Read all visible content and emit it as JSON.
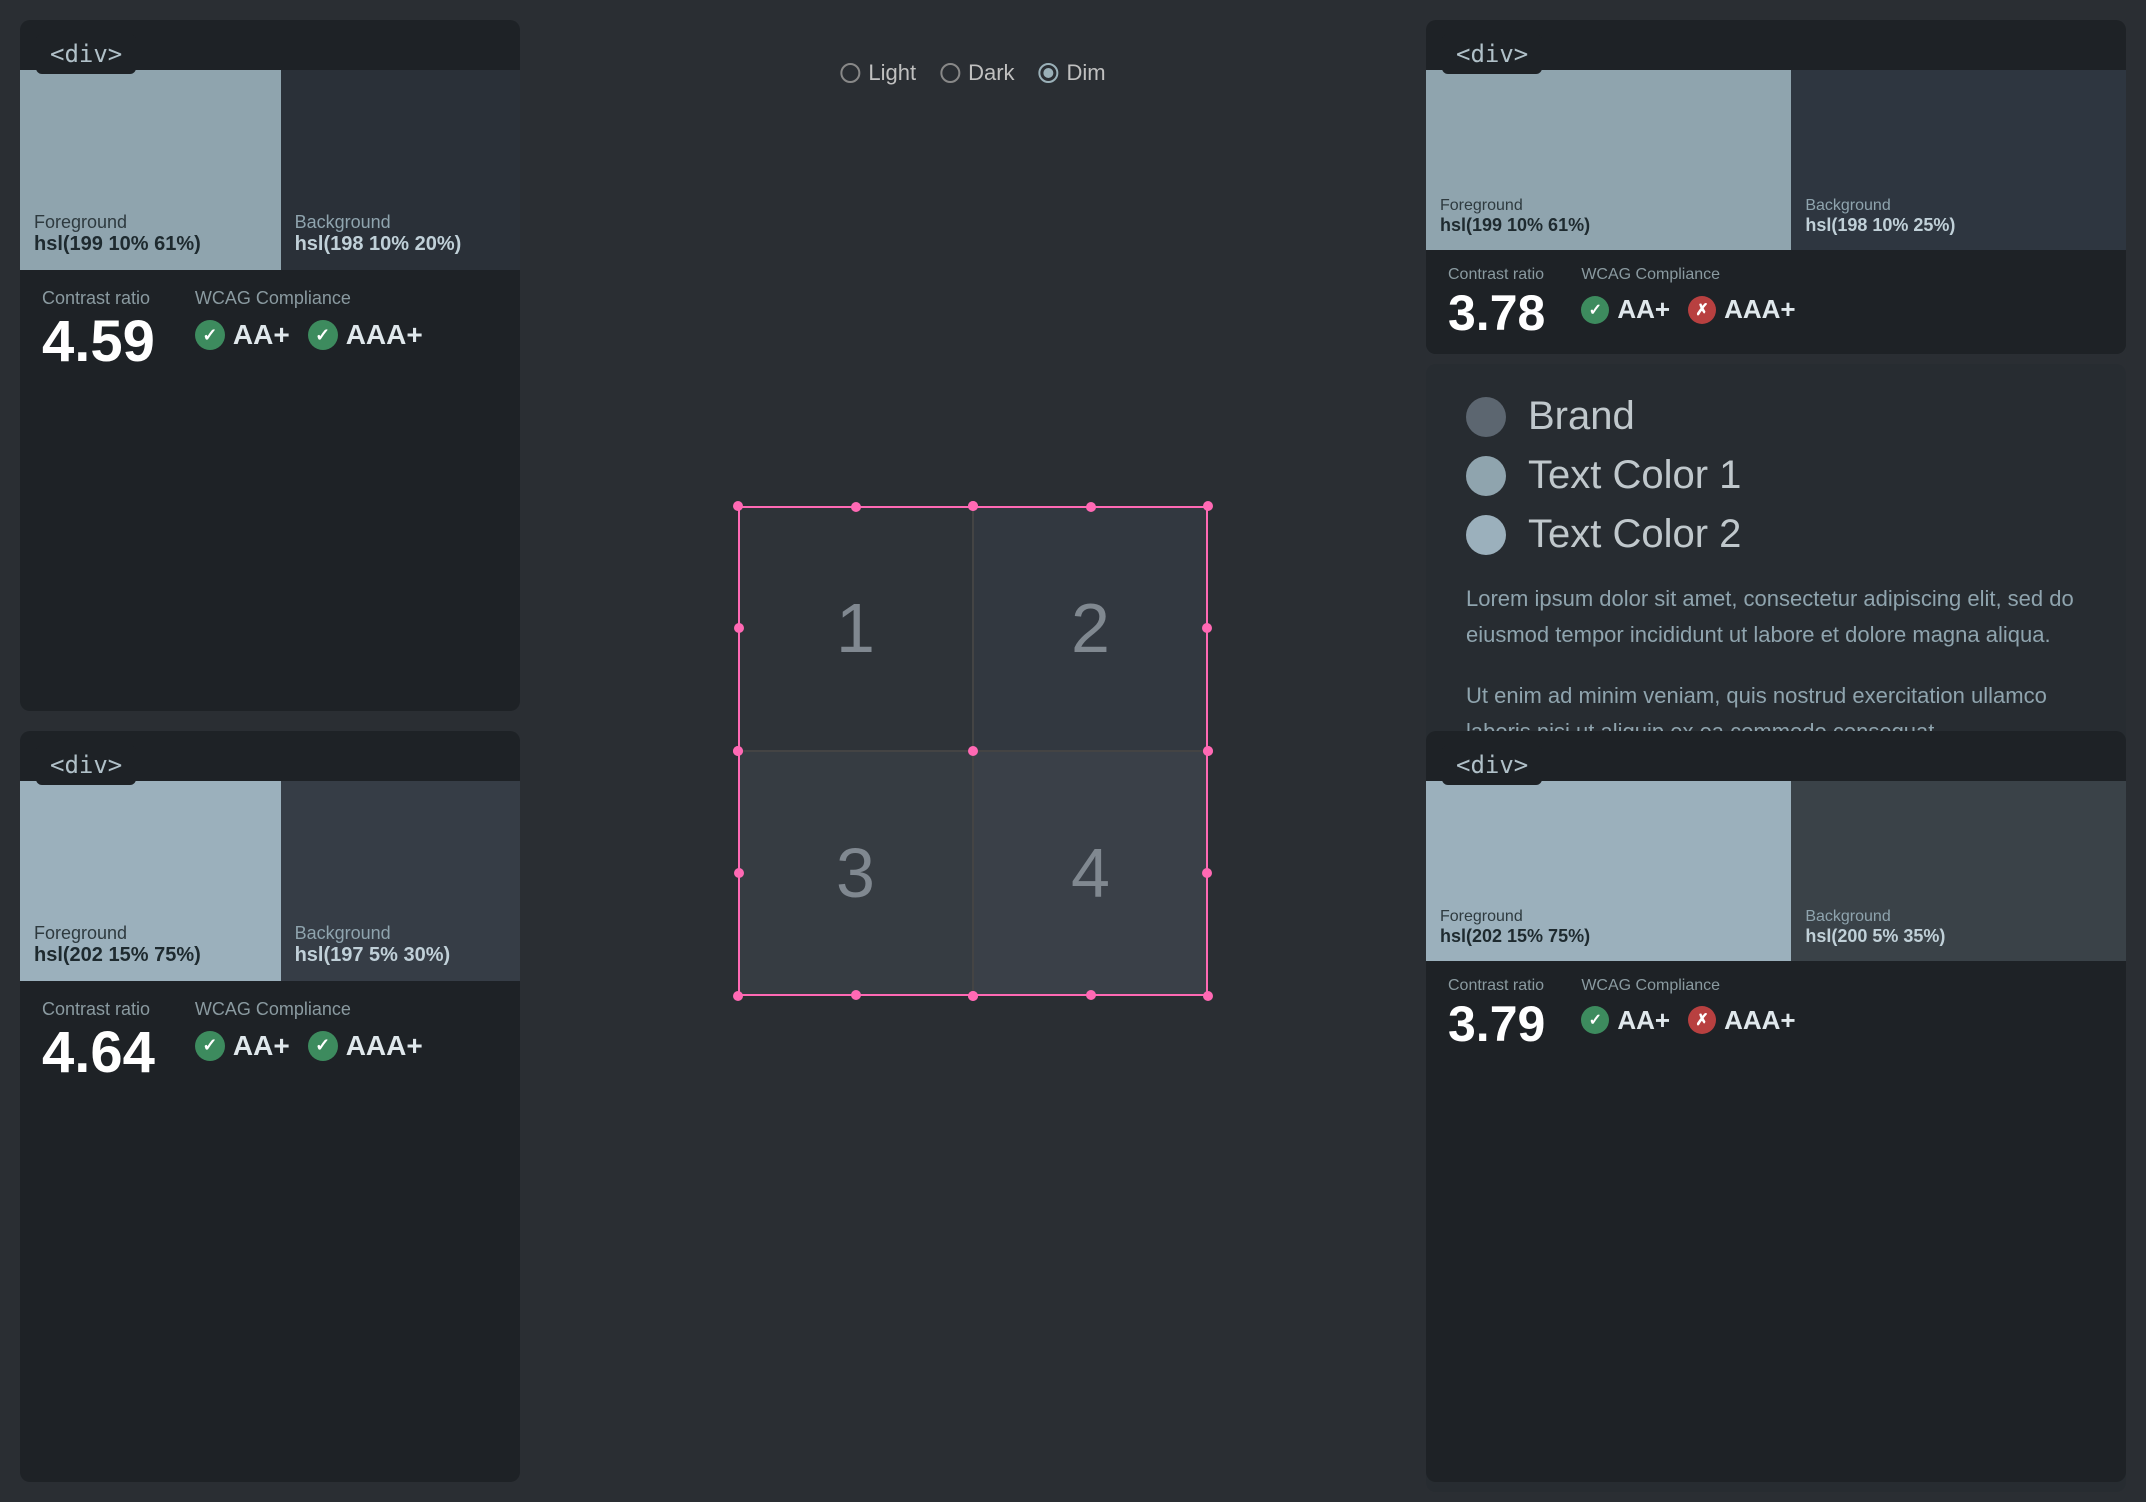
{
  "cards": {
    "top_left": {
      "title": "<div>",
      "fg_label": "Foreground",
      "fg_value": "hsl(199 10% 61%)",
      "bg_label": "Background",
      "bg_value": "hsl(198 10% 20%)",
      "contrast_label": "Contrast ratio",
      "contrast_value": "4.59",
      "wcag_label": "WCAG Compliance",
      "aa_label": "AA+",
      "aaa_label": "AAA+",
      "aa_pass": true,
      "aaa_pass": true
    },
    "top_right": {
      "title": "<div>",
      "fg_label": "Foreground",
      "fg_value": "hsl(199 10% 61%)",
      "bg_label": "Background",
      "bg_value": "hsl(198 10% 25%)",
      "contrast_label": "Contrast ratio",
      "contrast_value": "3.78",
      "wcag_label": "WCAG Compliance",
      "aa_label": "AA+",
      "aaa_label": "AAA+",
      "aa_pass": true,
      "aaa_pass": false
    },
    "bottom_left": {
      "title": "<div>",
      "fg_label": "Foreground",
      "fg_value": "hsl(202 15% 75%)",
      "bg_label": "Background",
      "bg_value": "hsl(197 5% 30%)",
      "contrast_label": "Contrast ratio",
      "contrast_value": "4.64",
      "wcag_label": "WCAG Compliance",
      "aa_label": "AA+",
      "aaa_label": "AAA+",
      "aa_pass": true,
      "aaa_pass": true
    },
    "bottom_right": {
      "title": "<div>",
      "fg_label": "Foreground",
      "fg_value": "hsl(202 15% 75%)",
      "bg_label": "Background",
      "bg_value": "hsl(200 5% 35%)",
      "contrast_label": "Contrast ratio",
      "contrast_value": "3.79",
      "wcag_label": "WCAG Compliance",
      "aa_label": "AA+",
      "aaa_label": "AAA+",
      "aa_pass": true,
      "aaa_pass": false
    }
  },
  "mode_selector": {
    "options": [
      "Light",
      "Dark",
      "Dim"
    ],
    "selected": "Dim"
  },
  "grid": {
    "cells": [
      "1",
      "2",
      "3",
      "4"
    ]
  },
  "legend": {
    "items": [
      {
        "label": "Brand",
        "color": "#5c6670"
      },
      {
        "label": "Text Color 1",
        "color": "#8fa4ae"
      },
      {
        "label": "Text Color 2",
        "color": "#9bb0bc"
      }
    ]
  },
  "body_paragraphs": [
    "Lorem ipsum dolor sit amet, consectetur adipiscing elit, sed do eiusmod tempor incididunt ut labore et dolore magna aliqua.",
    "Ut enim ad minim veniam, quis nostrud exercitation ullamco laboris nisi ut aliquip ex ea commodo consequat."
  ]
}
